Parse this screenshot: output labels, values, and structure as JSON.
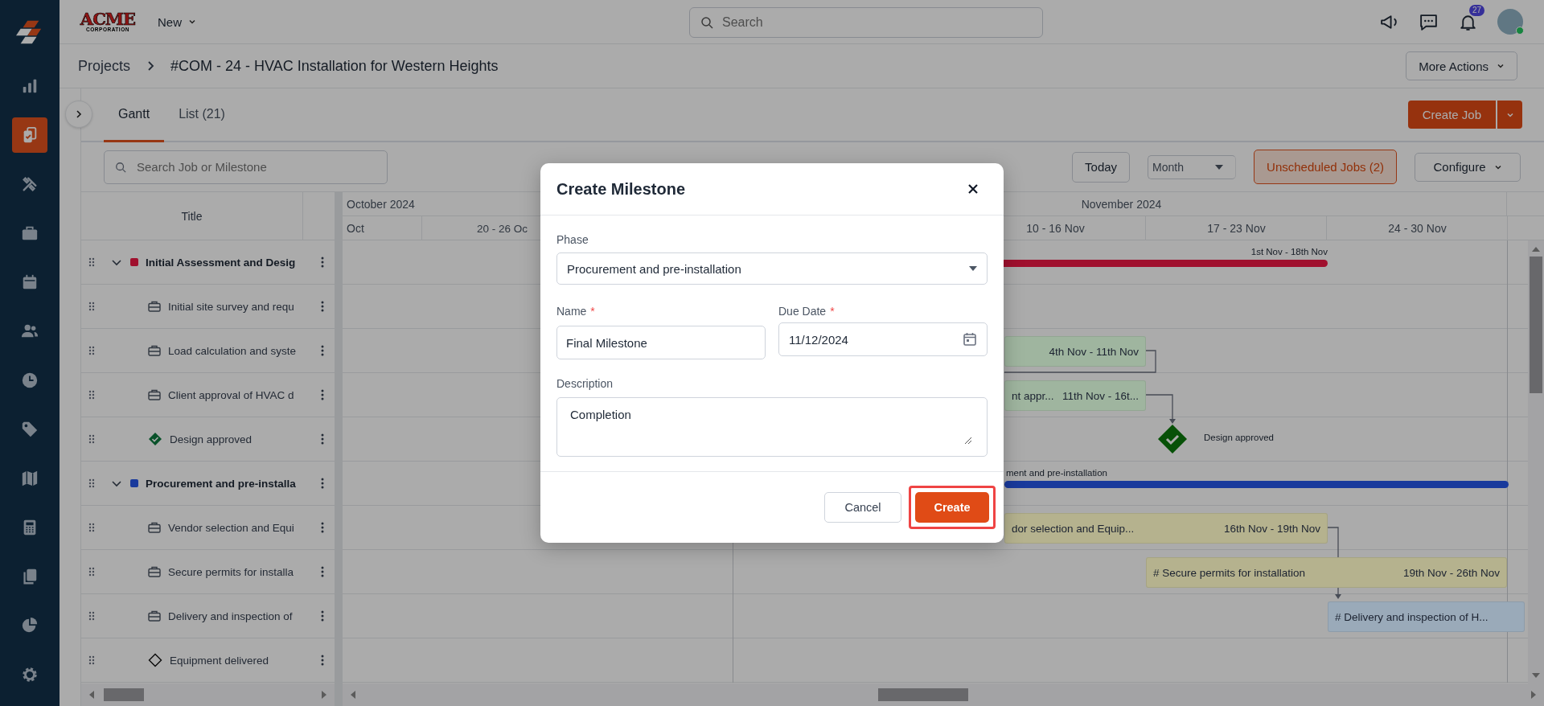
{
  "sidebar": {
    "items": [
      {
        "kind": "logo",
        "selected": false
      },
      {
        "kind": "chart",
        "selected": false
      },
      {
        "kind": "jobs",
        "selected": true
      },
      {
        "kind": "tools",
        "selected": false
      },
      {
        "kind": "briefcase",
        "selected": false
      },
      {
        "kind": "calendar",
        "selected": false
      },
      {
        "kind": "people",
        "selected": false
      },
      {
        "kind": "clock",
        "selected": false
      },
      {
        "kind": "tag",
        "selected": false
      },
      {
        "kind": "map",
        "selected": false
      },
      {
        "kind": "calculator",
        "selected": false
      },
      {
        "kind": "documents",
        "selected": false
      },
      {
        "kind": "pie",
        "selected": false
      },
      {
        "kind": "settings",
        "selected": false
      }
    ]
  },
  "top_bar": {
    "logo": {
      "name": "ACME",
      "tagline": "CORPORATION"
    },
    "new_menu": "New",
    "search": {
      "placeholder": "Search"
    },
    "notification_count": "27",
    "avatar": {
      "online": true
    }
  },
  "breadcrumb": {
    "items": [
      "Projects",
      "#COM - 24 - HVAC Installation for Western Heights"
    ],
    "more_actions": "More Actions"
  },
  "tabs": [
    {
      "label": "Gantt",
      "selected": true
    },
    {
      "label": "List (21)",
      "selected": false
    }
  ],
  "create_job": "Create Job",
  "toolbar": {
    "search": {
      "placeholder": "Search Job or Milestone"
    },
    "today": "Today",
    "view": "Month",
    "unscheduled": "Unscheduled Jobs (2)",
    "configure": "Configure"
  },
  "gantt": {
    "title_column": "Title",
    "months": [
      "October 2024",
      "November 2024"
    ],
    "weeks": [
      "Oct",
      "20 - 26 Oc",
      "10 - 16 Nov",
      "17 - 23 Nov",
      "24 - 30 Nov"
    ],
    "rows": [
      {
        "kind": "phase",
        "label": "Initial Assessment and Desig",
        "color": "#a0102e",
        "expanded": true,
        "bar": {
          "dates": "1st Nov - 18th Nov"
        }
      },
      {
        "kind": "job",
        "label": "Initial site survey and requ"
      },
      {
        "kind": "job",
        "label": "Load calculation and syste",
        "bar": {
          "color": "#9fb59f",
          "dates": "4th Nov - 11th Nov"
        }
      },
      {
        "kind": "job",
        "label": "Client approval of HVAC d",
        "bar": {
          "color": "#9fb59f",
          "name": "nt appr...",
          "dates": "11th Nov - 16t..."
        }
      },
      {
        "kind": "milestone",
        "label": "Design approved",
        "done": true,
        "marker": {
          "label": "Design approved"
        }
      },
      {
        "kind": "phase",
        "label": "Procurement and pre-installa",
        "color": "#193a9c",
        "expanded": true,
        "bar": {
          "name": "ment and pre-installation"
        }
      },
      {
        "kind": "job",
        "label": "Vendor selection and Equi",
        "bar": {
          "color": "#b5b28e",
          "dates": "16th Nov - 19th Nov",
          "name": "dor selection and Equip..."
        }
      },
      {
        "kind": "job",
        "label": "Secure permits for installa",
        "bar": {
          "color": "#b5b28e",
          "name": "# Secure permits for installation",
          "dates": "19th Nov - 26th Nov"
        }
      },
      {
        "kind": "job",
        "label": "Delivery and inspection of",
        "bar": {
          "color": "#9aaab9",
          "name": "# Delivery and inspection of H..."
        }
      },
      {
        "kind": "milestone",
        "label": "Equipment delivered",
        "done": false
      }
    ]
  },
  "dialog": {
    "title": "Create Milestone",
    "phase": {
      "label": "Phase",
      "value": "Procurement and pre-installation"
    },
    "name": {
      "label": "Name",
      "required_mark": "*",
      "value": "Final Milestone"
    },
    "due_date": {
      "label": "Due Date",
      "required_mark": "*",
      "value": "11/12/2024"
    },
    "description": {
      "label": "Description",
      "value": "Completion"
    },
    "cancel": "Cancel",
    "create": {
      "label": "Create",
      "highlighted": true
    }
  }
}
